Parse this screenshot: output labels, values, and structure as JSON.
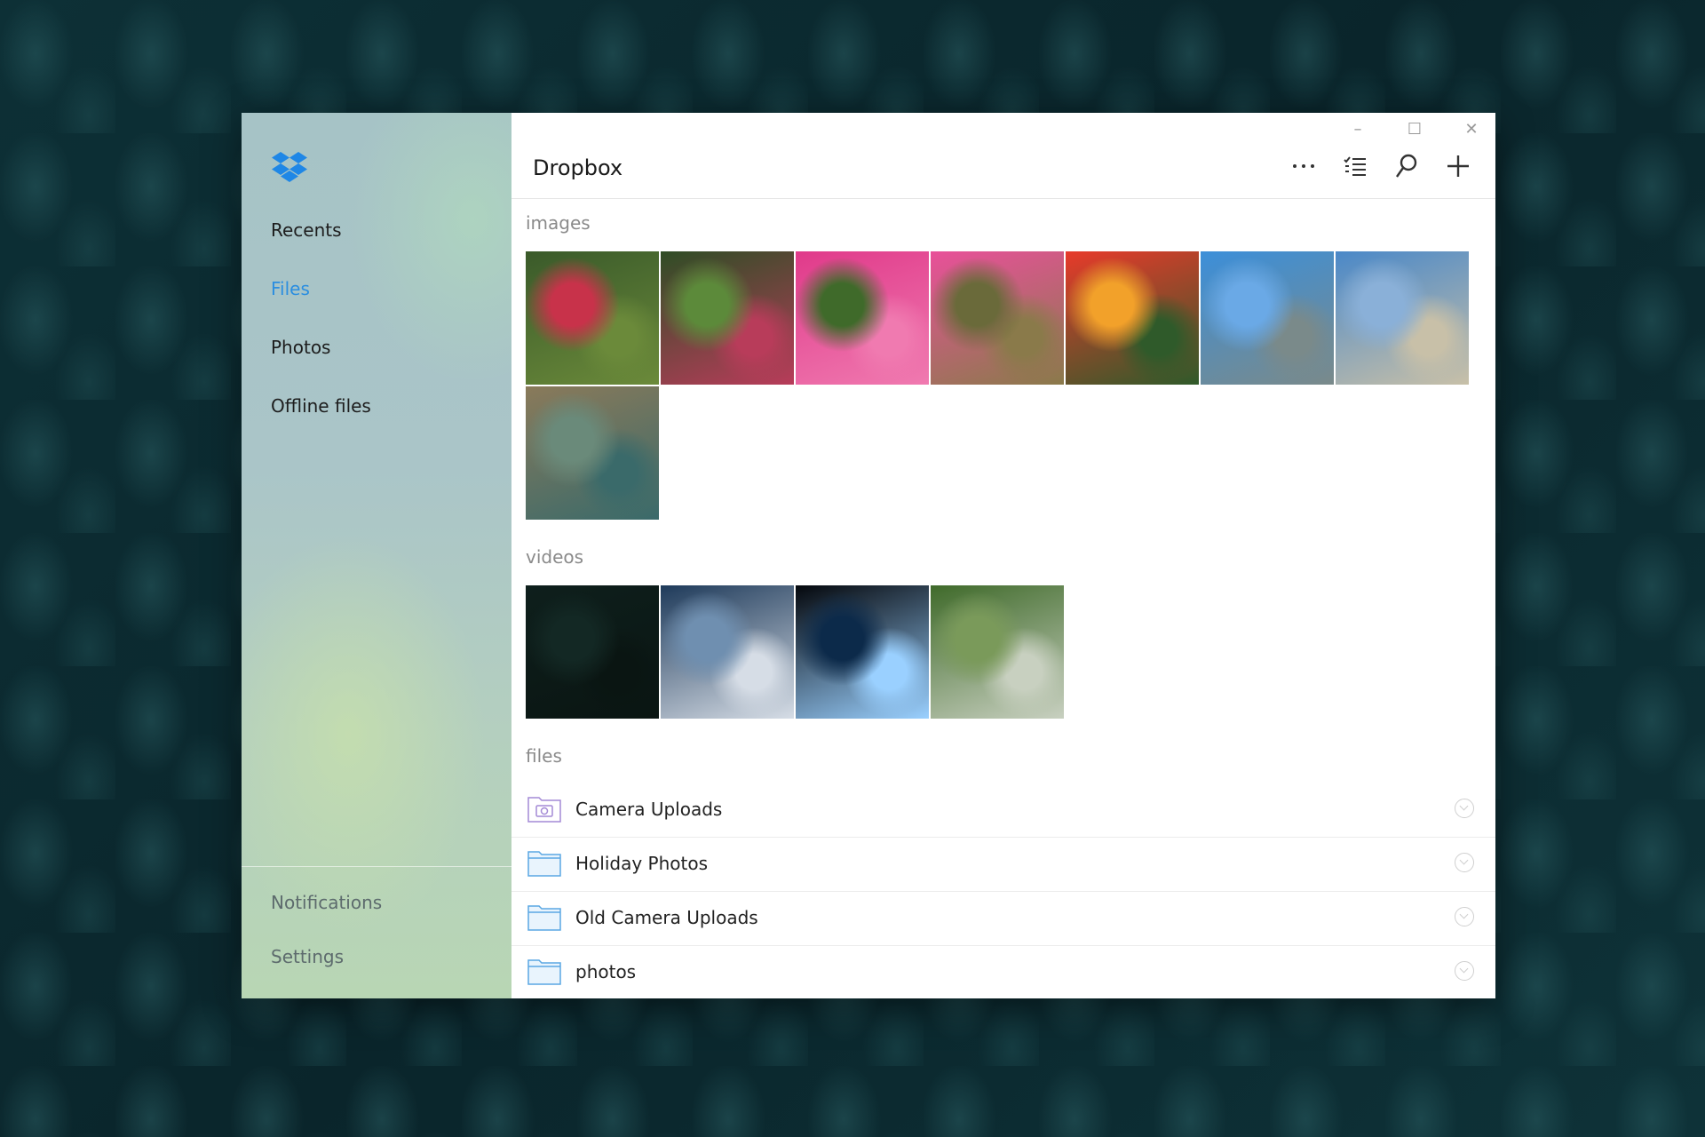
{
  "app": {
    "title": "Dropbox"
  },
  "sidebar": {
    "logo_icon": "dropbox-logo-icon",
    "items": [
      {
        "label": "Recents",
        "active": false
      },
      {
        "label": "Files",
        "active": true
      },
      {
        "label": "Photos",
        "active": false
      },
      {
        "label": "Offline files",
        "active": false
      }
    ],
    "bottom": {
      "notifications": "Notifications",
      "settings": "Settings"
    }
  },
  "window_controls": {
    "minimize": "–",
    "maximize": "☐",
    "close": "✕"
  },
  "toolbar": {
    "icons": [
      "more-icon",
      "select-list-icon",
      "search-icon",
      "add-icon"
    ]
  },
  "sections": {
    "images": {
      "label": "images",
      "thumbs": [
        {
          "icon": "photo-red-flowers",
          "colors": [
            "#3a5a2a",
            "#c8324a",
            "#6b8a3a"
          ]
        },
        {
          "icon": "photo-green-plants",
          "colors": [
            "#2f4d25",
            "#5c8a3a",
            "#b83c5a"
          ]
        },
        {
          "icon": "photo-pink-lily",
          "colors": [
            "#e03a8a",
            "#3f6a2a",
            "#f07ab0"
          ]
        },
        {
          "icon": "photo-pink-flower-cluster",
          "colors": [
            "#e9509a",
            "#6a6a3a",
            "#8a7a4a"
          ]
        },
        {
          "icon": "photo-red-bromeliad",
          "colors": [
            "#e83a2a",
            "#f2a12a",
            "#2f5a2a"
          ]
        },
        {
          "icon": "photo-bay-sky",
          "colors": [
            "#3c8fd9",
            "#6aa9e6",
            "#7a8a8a"
          ]
        },
        {
          "icon": "photo-bridge",
          "colors": [
            "#4a88c8",
            "#8ab0d8",
            "#c8c0a8"
          ]
        },
        {
          "icon": "photo-underwater",
          "colors": [
            "#8a7a5a",
            "#6a8a7a",
            "#3a6a6a"
          ]
        }
      ]
    },
    "videos": {
      "label": "videos",
      "thumbs": [
        {
          "icon": "video-dark-scene",
          "colors": [
            "#0e1f1c",
            "#132824",
            "#0a1512"
          ]
        },
        {
          "icon": "video-skydiving",
          "colors": [
            "#1e3a5a",
            "#6f8fb0",
            "#d6dde6"
          ]
        },
        {
          "icon": "video-studio-logo",
          "colors": [
            "#04070c",
            "#0c2a4a",
            "#9ad0ff"
          ]
        },
        {
          "icon": "video-garden",
          "colors": [
            "#3f6a2a",
            "#7a9a5a",
            "#c8d0c0"
          ]
        }
      ]
    },
    "files": {
      "label": "files",
      "items": [
        {
          "name": "Camera Uploads",
          "icon": "camera-folder-icon"
        },
        {
          "name": "Holiday Photos",
          "icon": "folder-icon"
        },
        {
          "name": "Old Camera Uploads",
          "icon": "folder-icon"
        },
        {
          "name": "photos",
          "icon": "folder-icon"
        }
      ]
    }
  }
}
